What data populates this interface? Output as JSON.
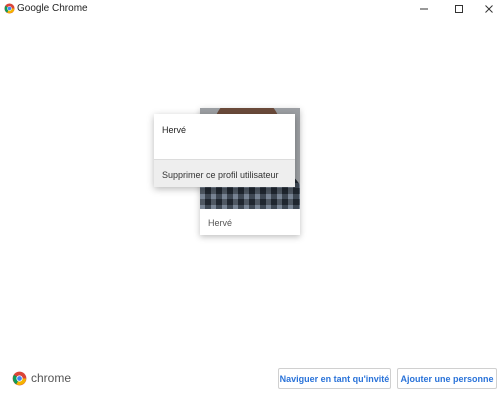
{
  "window": {
    "title": "Google Chrome"
  },
  "profile_card": {
    "name": "Hervé"
  },
  "context_menu": {
    "profile_name": "Hervé",
    "items": [
      {
        "label": "Supprimer ce profil utilisateur"
      }
    ]
  },
  "footer": {
    "brand": "chrome",
    "guest_button": "Naviguer en tant qu'invité",
    "add_person_button": "Ajouter une personne"
  },
  "colors": {
    "accent": "#2a73d9",
    "chrome_red": "#db4437",
    "chrome_green": "#0f9d58",
    "chrome_yellow": "#f4b400",
    "chrome_blue": "#4285f4"
  }
}
